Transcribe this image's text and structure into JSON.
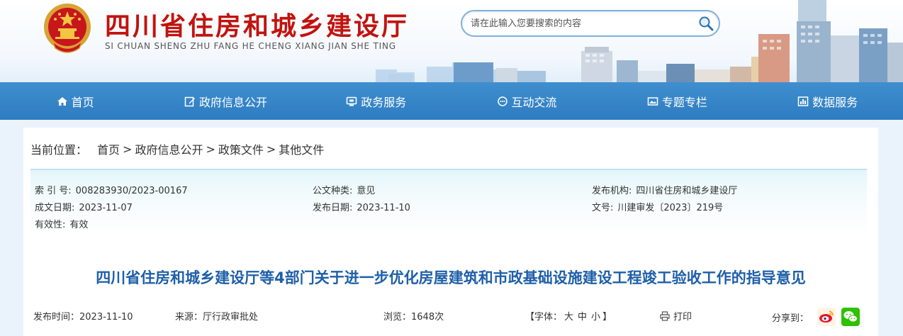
{
  "header": {
    "title": "四川省住房和城乡建设厅",
    "subtitle": "SI CHUAN SHENG ZHU FANG HE CHENG XIANG JIAN SHE TING"
  },
  "search": {
    "placeholder": "请在此输入您要搜索的内容"
  },
  "nav": {
    "items": [
      {
        "label": "首页",
        "icon": "home-icon"
      },
      {
        "label": "政府信息公开",
        "icon": "edit-icon"
      },
      {
        "label": "政务服务",
        "icon": "monitor-icon"
      },
      {
        "label": "互动交流",
        "icon": "chat-icon"
      },
      {
        "label": "专题专栏",
        "icon": "image-icon"
      },
      {
        "label": "数据服务",
        "icon": "chart-icon"
      }
    ]
  },
  "breadcrumb": {
    "label": "当前位置：",
    "items": [
      "首页",
      "政府信息公开",
      "政策文件",
      "其他文件"
    ],
    "separator": ">"
  },
  "meta": {
    "index_key": "索 引 号:",
    "index_value": "008283930/2023-00167",
    "type_key": "公文种类:",
    "type_value": "意见",
    "org_key": "发布机构:",
    "org_value": "四川省住房和城乡建设厅",
    "created_key": "成文日期:",
    "created_value": "2023-11-07",
    "published_key": "发布日期:",
    "published_value": "2023-11-10",
    "docno_key": "文号:",
    "docno_value": "川建审发〔2023〕219号",
    "validity_key": "有效性:",
    "validity_value": "有效"
  },
  "document": {
    "title": "四川省住房和城乡建设厅等4部门关于进一步优化房屋建筑和市政基础设施建设工程竣工验收工作的指导意见"
  },
  "info": {
    "time_label": "发布时间：",
    "time_value": "2023-11-10",
    "source_label": "来源：",
    "source_value": "厅行政审批处",
    "views_label": "浏览：",
    "views_value": "1648次",
    "font_open": "【字体：",
    "font_large": "大",
    "font_medium": "中",
    "font_small": "小",
    "font_close": "】",
    "print_label": "打印",
    "share_label": "分享到："
  },
  "colors": {
    "brand_red": "#c2130f",
    "nav_blue": "#2e7cc0",
    "title_blue": "#1e5fa8"
  }
}
